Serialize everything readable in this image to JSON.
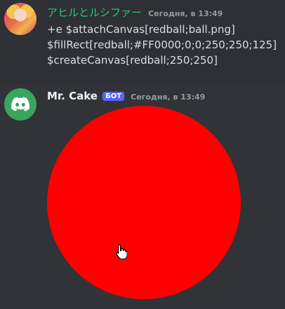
{
  "messages": [
    {
      "author": "アヒルとルシファー",
      "timestamp": "Сегодня, в 13:49",
      "lines": [
        "+e $attachCanvas[redball;ball.png]",
        "$fillRect[redball;#FF0000;0;0;250;250;125]",
        "$createCanvas[redball;250;250]"
      ]
    },
    {
      "author": "Mr. Cake",
      "badge": "БОТ",
      "timestamp": "Сегодня, в 13:49",
      "image_icon": "discord-icon",
      "ball_color": "#FF0000"
    }
  ],
  "colors": {
    "background": "#313338",
    "username_1": "#2dc770",
    "bot_badge": "#5865f2",
    "avatar_bot": "#3ba55d"
  }
}
